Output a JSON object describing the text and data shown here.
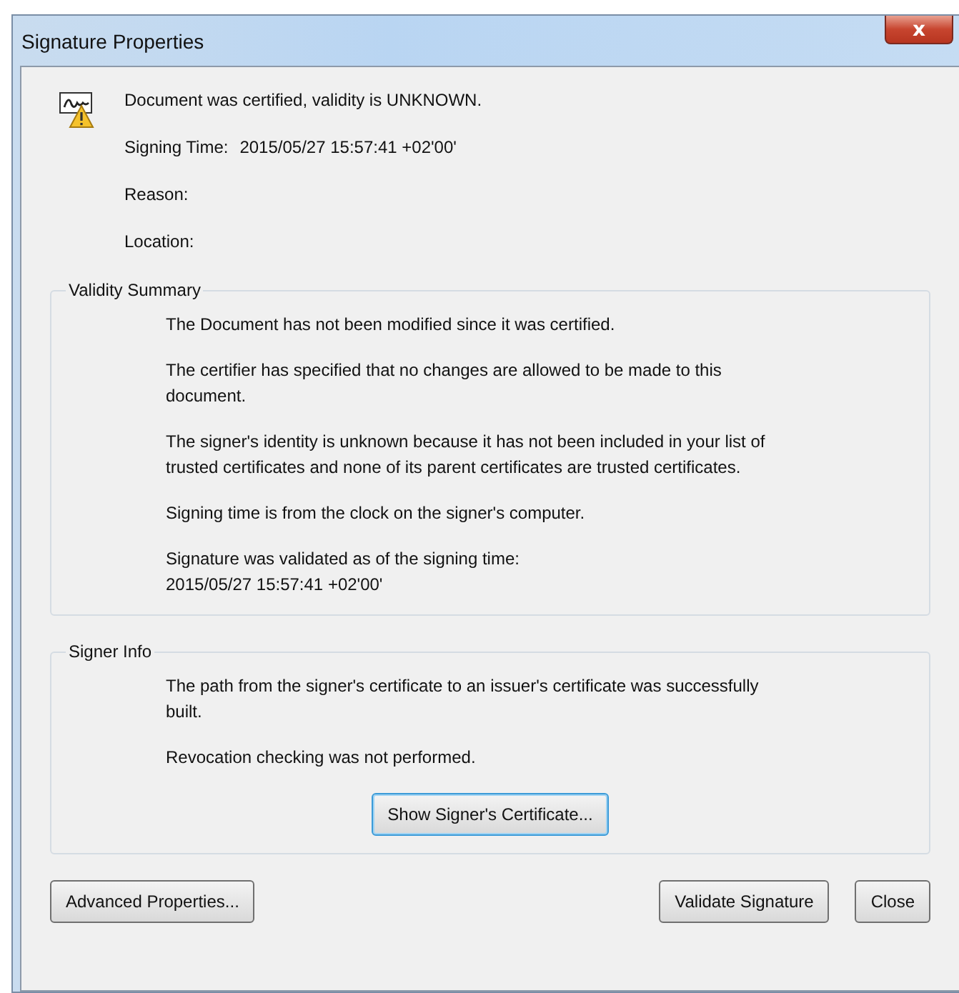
{
  "window": {
    "title": "Signature Properties",
    "close": "x"
  },
  "header": {
    "status": "Document was certified, validity is UNKNOWN.",
    "fields": [
      {
        "label": "Signing Time:",
        "value": "2015/05/27 15:57:41 +02'00'"
      },
      {
        "label": "Reason:"
      },
      {
        "label": "Location:"
      }
    ]
  },
  "groups": [
    {
      "title": "Validity Summary",
      "lines": [
        [
          "The Document has not been modified since it was certified."
        ],
        [
          "The certifier has specified that no changes are allowed to be made to this",
          "document."
        ],
        [
          "The signer's identity is unknown because it has not been included in your list of",
          "trusted certificates and none of its parent certificates are trusted certificates."
        ],
        [
          "Signing time is from the clock on the signer's computer."
        ],
        [
          "Signature was validated as of the signing time:",
          "2015/05/27 15:57:41 +02'00'"
        ]
      ]
    },
    {
      "title": "Signer Info",
      "lines": [
        [
          "The path from the signer's certificate to an issuer's certificate was successfully",
          "built."
        ],
        [
          "Revocation checking was not performed."
        ]
      ],
      "buttons": [
        {
          "label": "Show Signer's Certificate...",
          "focused": true
        }
      ]
    }
  ],
  "footer": {
    "left": [
      {
        "label": "Advanced Properties...",
        "focused": false
      }
    ],
    "right": [
      {
        "label": "Validate Signature",
        "focused": false
      },
      {
        "label": "Close",
        "focused": false
      }
    ]
  }
}
